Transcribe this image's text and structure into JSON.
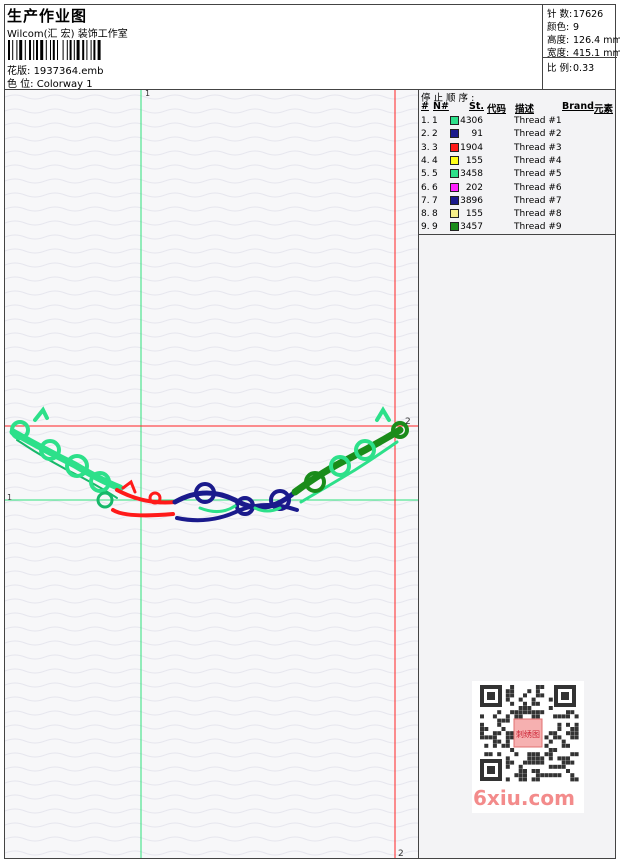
{
  "header": {
    "title": "生产作业图",
    "studio": "Wilcom(汇 宏) 装饰工作室",
    "design_label": "花版:",
    "design_file": "1937364.emb",
    "colorway_label": "色 位:",
    "colorway": "Colorway 1"
  },
  "stats": {
    "stitches_label": "针 数:",
    "stitches": "17626",
    "colors_label": "颜色:",
    "colors": "9",
    "height_label": "高度:",
    "height": "126.4 mm",
    "width_label": "宽度:",
    "width": "415.1 mm",
    "scale_label": "比 例:",
    "scale": "0.33"
  },
  "stop_sequence": {
    "heading": "停 止 顺 序 :",
    "columns": [
      "#",
      "N#",
      "St.",
      "代码",
      "描述",
      "Brand",
      "元素"
    ],
    "rows": [
      {
        "num": "1.",
        "n": "1",
        "color": "#2de08a",
        "stitches": "4306",
        "desc": "Thread #1"
      },
      {
        "num": "2.",
        "n": "2",
        "color": "#1a1a8c",
        "stitches": "91",
        "desc": "Thread #2"
      },
      {
        "num": "3.",
        "n": "3",
        "color": "#ff1a1a",
        "stitches": "1904",
        "desc": "Thread #3"
      },
      {
        "num": "4.",
        "n": "4",
        "color": "#ffff1a",
        "stitches": "155",
        "desc": "Thread #4"
      },
      {
        "num": "5.",
        "n": "5",
        "color": "#2de08a",
        "stitches": "3458",
        "desc": "Thread #5"
      },
      {
        "num": "6.",
        "n": "6",
        "color": "#ff22ff",
        "stitches": "202",
        "desc": "Thread #6"
      },
      {
        "num": "7.",
        "n": "7",
        "color": "#1a1a8c",
        "stitches": "3896",
        "desc": "Thread #7"
      },
      {
        "num": "8.",
        "n": "8",
        "color": "#f7ef8a",
        "stitches": "155",
        "desc": "Thread #8"
      },
      {
        "num": "9.",
        "n": "9",
        "color": "#1a8c1a",
        "stitches": "3457",
        "desc": "Thread #9"
      }
    ]
  },
  "guides": {
    "v1": "1",
    "h1": "1",
    "h2": "2",
    "v2": "2"
  },
  "watermark": {
    "site": "6xiu.com",
    "stamp": "刺绣图"
  }
}
